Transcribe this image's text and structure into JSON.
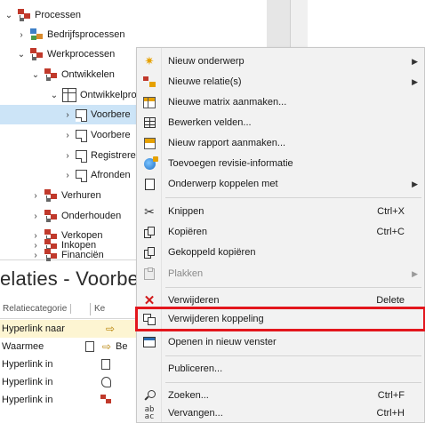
{
  "tree": {
    "items": [
      {
        "label": "Processen",
        "chevron": "⌄",
        "icon": "process-icon"
      },
      {
        "label": "Bedrijfsprocessen",
        "chevron": "›",
        "icon": "business-process-icon"
      },
      {
        "label": "Werkprocessen",
        "chevron": "⌄",
        "icon": "process-icon"
      },
      {
        "label": "Ontwikkelen",
        "chevron": "⌄",
        "icon": "process-icon"
      },
      {
        "label": "Ontwikkelpro",
        "chevron": "⌄",
        "icon": "grid-icon"
      },
      {
        "label": "Voorbere",
        "chevron": "›",
        "icon": "document-icon"
      },
      {
        "label": "Voorbere",
        "chevron": "›",
        "icon": "document-icon"
      },
      {
        "label": "Registrere",
        "chevron": "›",
        "icon": "document-icon"
      },
      {
        "label": "Afronden",
        "chevron": "›",
        "icon": "document-icon"
      },
      {
        "label": "Verhuren",
        "chevron": "›",
        "icon": "process-icon"
      },
      {
        "label": "Onderhouden",
        "chevron": "›",
        "icon": "process-icon"
      },
      {
        "label": "Verkopen",
        "chevron": "›",
        "icon": "process-icon"
      },
      {
        "label": "Inkopen",
        "chevron": "›",
        "icon": "process-icon"
      },
      {
        "label": "Financiën",
        "chevron": "›",
        "icon": "process-icon"
      }
    ]
  },
  "relaties": {
    "title": "elaties - Voorberei",
    "header": {
      "col1": "Relatiecategorie",
      "col3": "Ke"
    },
    "rows": [
      {
        "category": "Hyperlink naar",
        "target": ""
      },
      {
        "category": "Waarmee",
        "target": "Be"
      },
      {
        "category": "Hyperlink in",
        "target": ""
      },
      {
        "category": "Hyperlink in",
        "target": ""
      },
      {
        "category": "Hyperlink in",
        "target": ""
      }
    ]
  },
  "context_menu": {
    "items": [
      {
        "label": "Nieuw onderwerp",
        "shortcut": "",
        "submenu": true,
        "icon": "star-icon",
        "disabled": false
      },
      {
        "label": "Nieuwe relatie(s)",
        "shortcut": "",
        "submenu": true,
        "icon": "relation-icon",
        "disabled": false
      },
      {
        "label": "Nieuwe matrix aanmaken...",
        "shortcut": "",
        "submenu": false,
        "icon": "matrix-icon",
        "disabled": false
      },
      {
        "label": "Bewerken velden...",
        "shortcut": "",
        "submenu": false,
        "icon": "table-icon",
        "disabled": false
      },
      {
        "label": "Nieuw rapport aanmaken...",
        "shortcut": "",
        "submenu": false,
        "icon": "report-icon",
        "disabled": false
      },
      {
        "label": "Toevoegen revisie-informatie",
        "shortcut": "",
        "submenu": false,
        "icon": "globe-icon",
        "disabled": false
      },
      {
        "label": "Onderwerp koppelen met",
        "shortcut": "",
        "submenu": true,
        "icon": "page-icon",
        "disabled": false
      },
      {
        "label": "Knippen",
        "shortcut": "Ctrl+X",
        "submenu": false,
        "icon": "scissors-icon",
        "disabled": false
      },
      {
        "label": "Kopiëren",
        "shortcut": "Ctrl+C",
        "submenu": false,
        "icon": "copy-icon",
        "disabled": false
      },
      {
        "label": "Gekoppeld kopiëren",
        "shortcut": "",
        "submenu": false,
        "icon": "linked-copy-icon",
        "disabled": false
      },
      {
        "label": "Plakken",
        "shortcut": "",
        "submenu": true,
        "icon": "paste-icon",
        "disabled": true
      },
      {
        "label": "Verwijderen",
        "shortcut": "Delete",
        "submenu": false,
        "icon": "delete-x-icon",
        "disabled": false
      },
      {
        "label": "Verwijderen koppeling",
        "shortcut": "",
        "submenu": false,
        "icon": "unlink-icon",
        "disabled": false
      },
      {
        "label": "Openen in nieuw venster",
        "shortcut": "",
        "submenu": false,
        "icon": "window-icon",
        "disabled": false
      },
      {
        "label": "Publiceren...",
        "shortcut": "",
        "submenu": false,
        "icon": "",
        "disabled": false
      },
      {
        "label": "Zoeken...",
        "shortcut": "Ctrl+F",
        "submenu": false,
        "icon": "search-icon",
        "disabled": false
      },
      {
        "label": "Vervangen...",
        "shortcut": "Ctrl+H",
        "submenu": false,
        "icon": "replace-icon",
        "disabled": false
      }
    ],
    "highlighted_item": "Verwijderen koppeling",
    "highlight_color": "#e3161d"
  },
  "colors": {
    "selection": "#cce4f7",
    "row_highlight": "#fdf5d2",
    "menu_background": "#f2f2f2",
    "process_red": "#c0392b",
    "accent_orange": "#e6a100"
  }
}
